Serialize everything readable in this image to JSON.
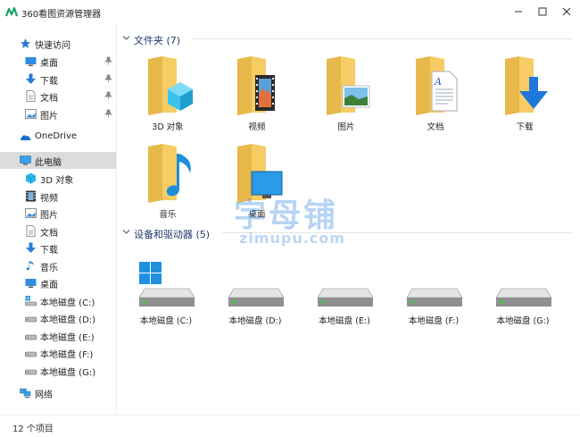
{
  "window": {
    "title": "360看图资源管理器"
  },
  "sidebar": {
    "quick_access": "快速访问",
    "quick_items": [
      "桌面",
      "下载",
      "文档",
      "图片"
    ],
    "onedrive": "OneDrive",
    "this_pc": "此电脑",
    "pc_items": [
      "3D 对象",
      "视频",
      "图片",
      "文档",
      "下载",
      "音乐",
      "桌面"
    ],
    "drives": [
      "本地磁盘 (C:)",
      "本地磁盘 (D:)",
      "本地磁盘 (E:)",
      "本地磁盘 (F:)",
      "本地磁盘 (G:)"
    ],
    "network": "网络"
  },
  "main": {
    "folders_group": "文件夹 (7)",
    "folders": [
      "3D 对象",
      "视频",
      "图片",
      "文档",
      "下载",
      "音乐",
      "桌面"
    ],
    "devices_group": "设备和驱动器 (5)",
    "drives": [
      "本地磁盘 (C:)",
      "本地磁盘 (D:)",
      "本地磁盘 (E:)",
      "本地磁盘 (F:)",
      "本地磁盘 (G:)"
    ]
  },
  "status": {
    "count": "12 个项目"
  },
  "watermark": {
    "main": "字母铺",
    "url": "zimupu.com"
  },
  "colors": {
    "accent": "#1e78dc",
    "folder": "#f5c85a",
    "selected": "#dcdcdc"
  }
}
